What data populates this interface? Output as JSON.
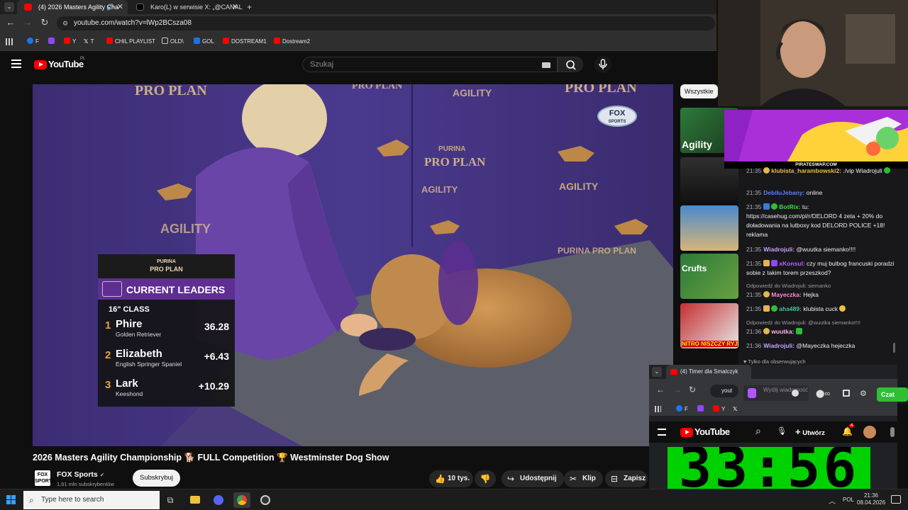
{
  "browser": {
    "tabs": [
      {
        "title": "(4) 2026 Masters Agility Cha",
        "active": true
      },
      {
        "title": "Karo(L) w serwisie X: „@CANAL",
        "active": false
      }
    ],
    "new_tab": "+",
    "url": "youtube.com/watch?v=lWp2BCsza08",
    "bookmarks": [
      {
        "label": "F",
        "color": "#1877f2"
      },
      {
        "label": "",
        "color": "#9146ff"
      },
      {
        "label": "Y",
        "color": "#ff0000"
      },
      {
        "label": "T",
        "color": "#000000"
      },
      {
        "label": "CHIL PLAYLIST",
        "color": "#ff0000"
      },
      {
        "label": "OLD\\",
        "color": "#cfcfcf"
      },
      {
        "label": "GOL",
        "color": "#1a73e8"
      },
      {
        "label": "DOSTREAM1",
        "color": "#ff0000"
      },
      {
        "label": "Dostream2",
        "color": "#ff0000"
      }
    ]
  },
  "youtube": {
    "logo": "YouTube",
    "region": "PL",
    "search_placeholder": "Szukaj",
    "video_title": "2026 Masters Agility Championship 🐕 FULL Competition 🏆 Westminster Dog Show",
    "channel_name": "FOX Sports",
    "channel_avatar": "FOX SPORTS",
    "channel_subs": "1,61 mln subskrybentów",
    "subscribe_label": "Subskrybuj",
    "likes": "10 tys.",
    "share_label": "Udostępnij",
    "clip_label": "Klip",
    "save_label": "Zapisz",
    "filter_chip": "Wszystkie",
    "recs": [
      {
        "label": "Agility"
      },
      {
        "label": ""
      },
      {
        "label": ""
      },
      {
        "label": "Crufts"
      },
      {
        "label": "NITRO NISZCZY RYJ"
      }
    ]
  },
  "video_overlay": {
    "backdrop_texts": [
      "PRO PLAN",
      "PRO PLAN",
      "PRO PLAN",
      "AGILITY",
      "PURINA",
      "PRO PLAN",
      "AGILITY",
      "AGILITY",
      "AGILITY",
      "PURINA PRO PLAN"
    ],
    "fox_logo": "FOX",
    "fox_logo_sub": "SPORTS",
    "leaders": {
      "brand_top": "PURINA",
      "brand": "PRO PLAN",
      "title": "CURRENT LEADERS",
      "class": "16\" CLASS",
      "rows": [
        {
          "rank": "1",
          "name": "Phire",
          "breed": "Golden Retriever",
          "score": "36.28"
        },
        {
          "rank": "2",
          "name": "Elizabeth",
          "breed": "English Springer Spaniel",
          "score": "+6.43"
        },
        {
          "rank": "3",
          "name": "Lark",
          "breed": "Keeshond",
          "score": "+10.29"
        }
      ]
    }
  },
  "chat": {
    "promo_label": "PIRATESWAP.COM",
    "messages": [
      {
        "time": "21:35",
        "user": "klubista_harambowski2:",
        "color": "#e2b84a",
        "text": "./vip Wiadrojuli"
      },
      {
        "time": "21:35",
        "user": "DebiluJebany:",
        "color": "#5c7cff",
        "text": "online"
      },
      {
        "time": "21:35",
        "user": "BotRix:",
        "color": "#3de03d",
        "text": "tu: https://casehug.com/pl/r/DELORD 4 zeta + 20% do doładowania na lutboxy kod DELORD POLICE +18! reklama"
      },
      {
        "time": "21:35",
        "user": "Wiadrojuli:",
        "color": "#c8a2ff",
        "text": "@wuutka siemanko!!!!"
      },
      {
        "time": "21:35",
        "user": "xKonsul:",
        "color": "#b162ff",
        "text": "czy muj bulbog francuski poradzi sobie z takim torem przeszkod?"
      },
      {
        "time": "21:35",
        "user": "Mayeczka:",
        "color": "#ff8ad8",
        "text": "Hejka",
        "reply": "Odpowiedź do Wiadrojuli: siemanko"
      },
      {
        "time": "21:35",
        "user": "aha489:",
        "color": "#44c0a0",
        "text": "klubista cuck"
      },
      {
        "time": "21:36",
        "user": "wuutka:",
        "color": "#ffb3e6",
        "text": "",
        "reply": "Odpowiedź do Wiadrojuli: @wuutka siemanko!!!!"
      },
      {
        "time": "21:36",
        "user": "Wiadrojuli:",
        "color": "#c8a2ff",
        "text": "@Mayeczka hejeczka"
      }
    ],
    "followers_only": "Tylko dla obserwujących",
    "input_placeholder": "Wyślij wiadomość",
    "send_label": "Czat"
  },
  "mini_browser": {
    "tab_title": "(4) Timer dla Smalczyk",
    "url": "yout",
    "create_label": "Utwórz",
    "notif_count": "4",
    "timer": "33:56"
  },
  "taskbar": {
    "search_placeholder": "Type here to search",
    "lang": "POL",
    "time": "21:36",
    "date": "08.04.2026"
  }
}
